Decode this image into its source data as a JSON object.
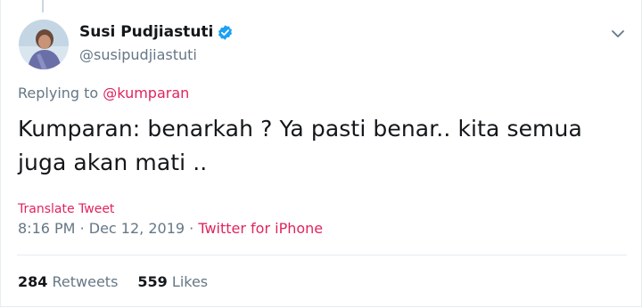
{
  "tweet": {
    "author": {
      "display_name": "Susi Pudjiastuti",
      "handle": "@susipudjiastuti",
      "verified": true,
      "avatar": "profile-photo"
    },
    "reply": {
      "prefix": "Replying to",
      "target": "@kumparan"
    },
    "text": "Kumparan: benarkah ? Ya pasti benar.. kita semua juga akan mati ..",
    "translate_label": "Translate Tweet",
    "time": "8:16 PM",
    "sep1": "·",
    "date": "Dec 12, 2019",
    "sep2": "·",
    "source": "Twitter for iPhone",
    "stats": {
      "retweets_count": "284",
      "retweets_label": "Retweets",
      "likes_count": "559",
      "likes_label": "Likes"
    }
  },
  "colors": {
    "accent": "#e0245e",
    "verified": "#1da1f2",
    "muted": "#657786",
    "text": "#14171a"
  },
  "icons": {
    "verified": "verified-badge-icon",
    "menu": "chevron-down-icon"
  }
}
